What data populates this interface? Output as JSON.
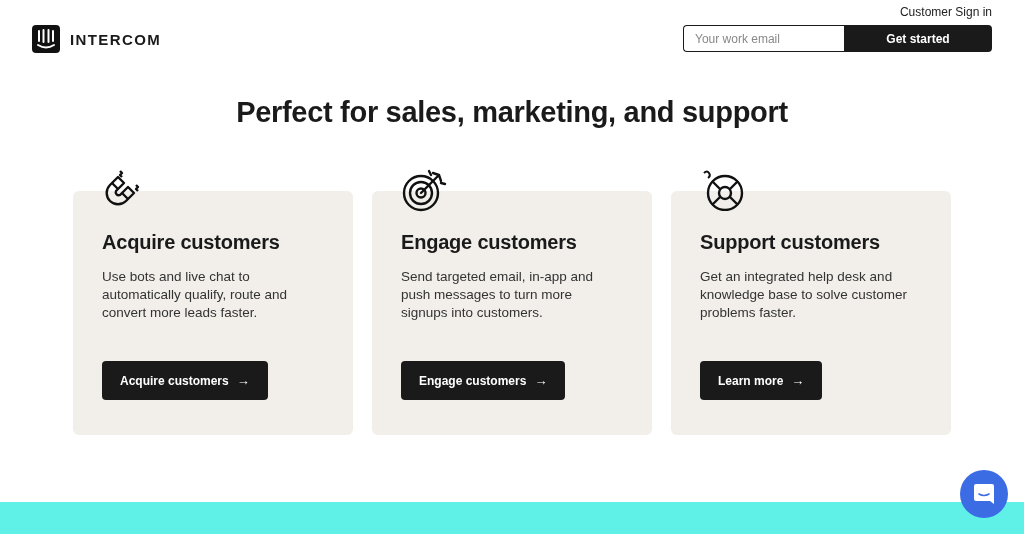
{
  "header": {
    "brand": "INTERCOM",
    "sign_in": "Customer Sign in",
    "email": {
      "placeholder": "Your work email"
    },
    "cta": "Get started"
  },
  "heading": "Perfect for sales, marketing, and support",
  "cards": [
    {
      "kind": "magnet",
      "title": "Acquire customers",
      "text": "Use bots and live chat to automatically qualify, route and convert more leads faster.",
      "button": "Acquire customers",
      "arrow": "→"
    },
    {
      "kind": "target",
      "title": "Engage customers",
      "text": "Send targeted email, in-app and push messages to turn more signups into customers.",
      "button": "Engage customers",
      "arrow": "→"
    },
    {
      "kind": "lifebuoy",
      "title": "Support customers",
      "text": "Get an integrated help desk and knowledge base to solve customer problems faster.",
      "button": "Learn more",
      "arrow": "→"
    }
  ]
}
